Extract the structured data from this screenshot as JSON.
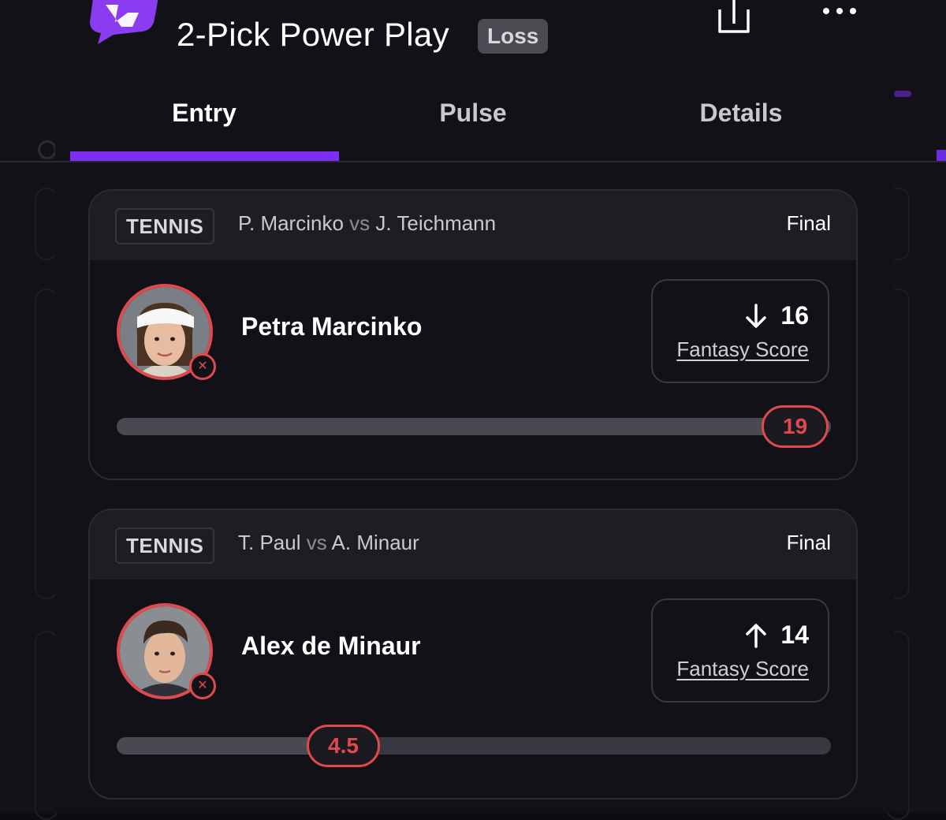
{
  "header": {
    "title": "2-Pick Power Play",
    "result_badge": "Loss"
  },
  "tabs": [
    {
      "label": "Entry",
      "active": true
    },
    {
      "label": "Pulse",
      "active": false
    },
    {
      "label": "Details",
      "active": false
    }
  ],
  "picks": [
    {
      "sport": "TENNIS",
      "team_a": "P. Marcinko",
      "vs": "vs",
      "team_b": "J. Teichmann",
      "status": "Final",
      "player": "Petra Marcinko",
      "direction": "down",
      "score": "16",
      "stat_label": "Fantasy Score",
      "line": "19",
      "progress_fraction": 1.0
    },
    {
      "sport": "TENNIS",
      "team_a": "T. Paul",
      "vs": "vs",
      "team_b": "A. Minaur",
      "status": "Final",
      "player": "Alex de Minaur",
      "direction": "up",
      "score": "14",
      "stat_label": "Fantasy Score",
      "line": "4.5",
      "progress_fraction": 0.3
    }
  ],
  "colors": {
    "accent": "#7b2ff2",
    "loss": "#e0494d",
    "background": "#121117",
    "card_header": "#1e1d24"
  },
  "icons": {
    "logo": "brand-logo-icon",
    "share": "share-icon",
    "more": "more-icon",
    "miss": "close-icon",
    "down": "arrow-down-icon",
    "up": "arrow-up-icon"
  }
}
